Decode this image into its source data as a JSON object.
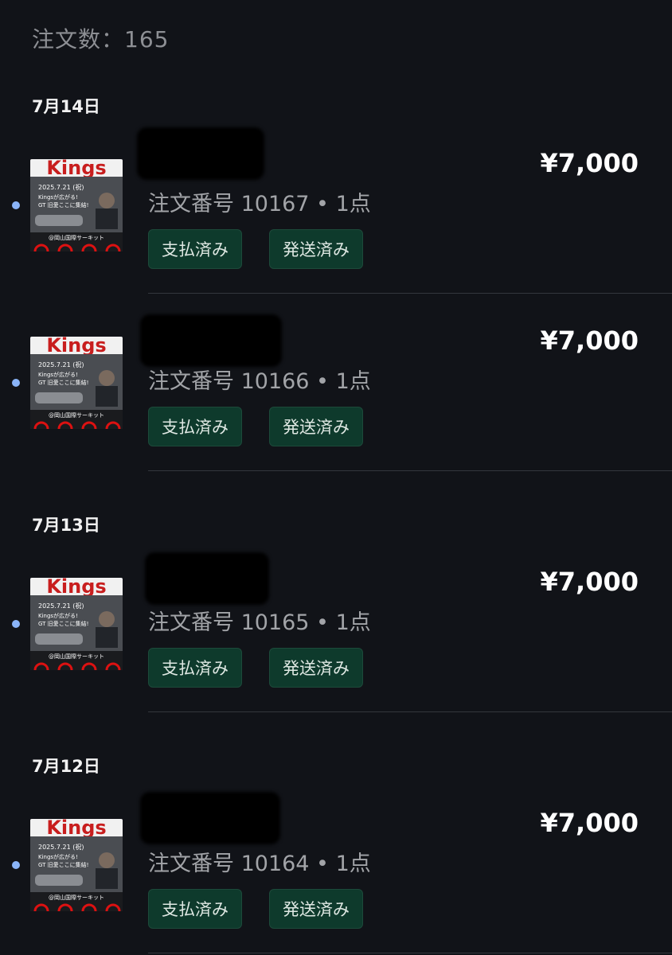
{
  "header": {
    "order_count": "注文数：165"
  },
  "sections": [
    {
      "date": "7月14日",
      "orders": [
        {
          "order_number": "注文番号 10167 • 1点",
          "price": "¥7,000",
          "payment_status": "支払済み",
          "shipping_status": "発送済み"
        },
        {
          "order_number": "注文番号 10166 • 1点",
          "price": "¥7,000",
          "payment_status": "支払済み",
          "shipping_status": "発送済み"
        }
      ]
    },
    {
      "date": "7月13日",
      "orders": [
        {
          "order_number": "注文番号 10165 • 1点",
          "price": "¥7,000",
          "payment_status": "支払済み",
          "shipping_status": "発送済み"
        }
      ]
    },
    {
      "date": "7月12日",
      "orders": [
        {
          "order_number": "注文番号 10164 • 1点",
          "price": "¥7,000",
          "payment_status": "支払済み",
          "shipping_status": "発送済み"
        }
      ]
    }
  ],
  "thumbnail": {
    "title_text": "Kings",
    "date_text": "2025.7.21 (祝)",
    "line1": "Kingsが広がる!",
    "line2": "GT 旧愛ここに集結!",
    "venue": "@岡山国際サーキット"
  },
  "colors": {
    "background": "#111318",
    "badge_bg": "#0e3a2c",
    "unread_dot": "#8ab4f8",
    "muted_text": "#a2a4a8"
  }
}
